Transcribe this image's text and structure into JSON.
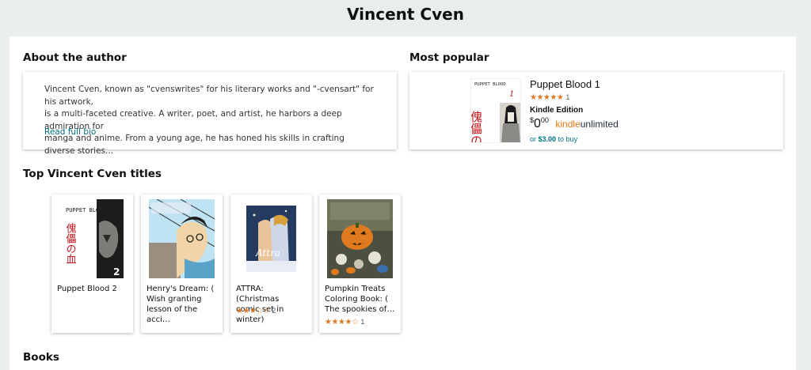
{
  "page": {
    "title": "Vincent Cven"
  },
  "about": {
    "heading": "About the author",
    "bio_line1": "Vincent Cven, known as \"cvenswrites\" for his literary works and \"-cvensart\" for his artwork,",
    "bio_line2": "is a multi-faceted creative. A writer, poet, and artist, he harbors a deep admiration for",
    "bio_line3": "manga and anime. From a young age, he has honed his skills in crafting diverse stories...",
    "read_more": "Read full bio"
  },
  "popular": {
    "heading": "Most popular",
    "title": "Puppet Blood 1",
    "stars": "★★★★★",
    "rating_count": "1",
    "edition": "Kindle Edition",
    "price_dollar": "$",
    "price_whole": "0",
    "price_cents": "00",
    "ku_part1": "kindle",
    "ku_part2": "unlimited",
    "buy_prefix": "or ",
    "buy_price": "$3.00",
    "buy_suffix": " to buy",
    "cover_text": "PUPPET BLOOD",
    "cover_kanji": "傀儡の血",
    "cover_number": "1"
  },
  "top_titles": {
    "heading": "Top Vincent Cven titles",
    "items": [
      {
        "title_line1": "Puppet Blood 2",
        "title_line2": "",
        "title_line3": "",
        "stars": "",
        "count": "",
        "cover_text": "PUPPET BLOOD",
        "cover_kanji": "傀儡の血",
        "cover_number": "2"
      },
      {
        "title_line1": "Henry's Dream: (",
        "title_line2": "Wish granting",
        "title_line3": "lesson of the acci…",
        "stars": "",
        "count": ""
      },
      {
        "title_line1": "ATTRA: (Christmas",
        "title_line2": "comic set in winter)",
        "title_line3": "",
        "stars": "★★★☆☆",
        "count": "2",
        "cover_text": "Attra"
      },
      {
        "title_line1": "Pumpkin Treats",
        "title_line2": "Coloring Book: (",
        "title_line3": "The spookies of…",
        "stars": "★★★★☆",
        "count": "1"
      }
    ]
  },
  "books": {
    "heading": "Books"
  },
  "colors": {
    "link": "#007185",
    "star": "#de7921",
    "background": "#eaeded"
  }
}
